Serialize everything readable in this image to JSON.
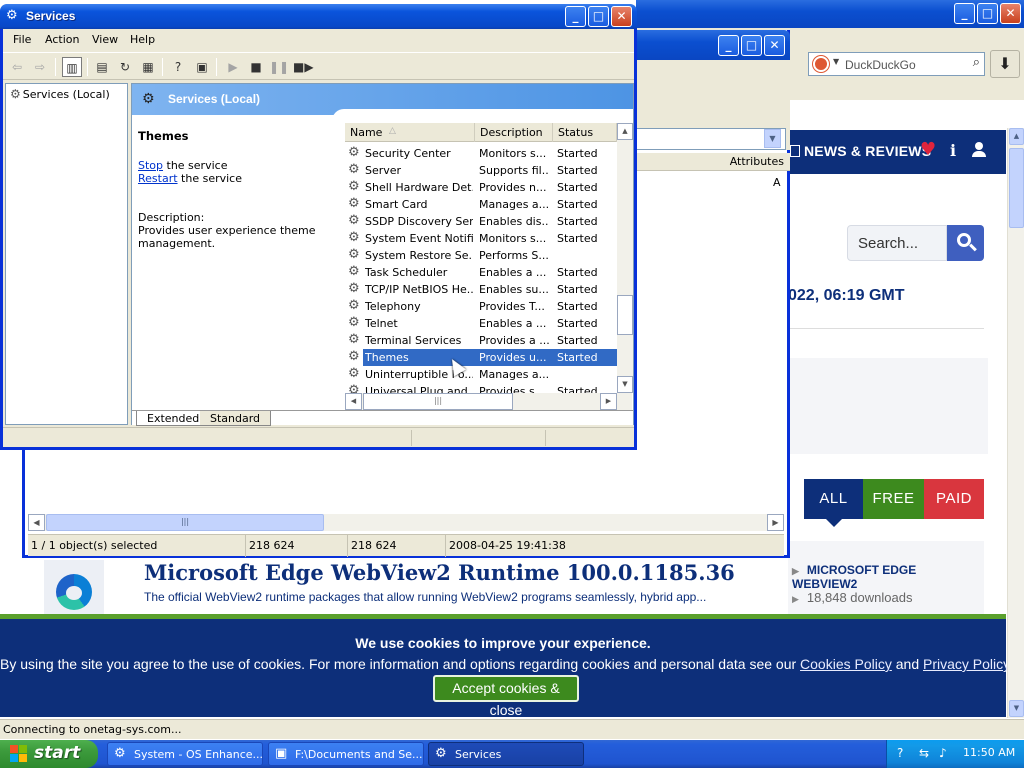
{
  "browser": {
    "search_placeholder": "DuckDuckGo",
    "nav": {
      "news": "NEWS & REVIEWS"
    },
    "site_search_placeholder": "Search...",
    "date_text": "022, 06:19 GMT",
    "filter_tabs": [
      "ALL",
      "FREE",
      "PAID"
    ],
    "side_link": "MICROSOFT EDGE WEBVIEW2",
    "side_downloads": "18,848 downloads",
    "product_title": "Microsoft Edge WebView2 Runtime 100.0.1185.36",
    "product_desc": "The official WebView2 runtime packages that allow running WebView2 programs seamlessly, hybrid app...",
    "cookie": {
      "title": "We use cookies to improve your experience.",
      "text_before": "By using the site you agree to the use of cookies. For more information and options regarding cookies and personal data see our ",
      "cookies_policy": "Cookies Policy",
      "and": " and ",
      "privacy_policy": "Privacy Policy",
      "accept": "Accept cookies & close"
    },
    "status": "Connecting to onetag-sys.com..."
  },
  "explorer": {
    "column_attributes": "Attributes",
    "attr_value": "A",
    "status": {
      "selected": "1 / 1 object(s) selected",
      "size1": "218 624",
      "size2": "218 624",
      "date": "2008-04-25 19:41:38"
    }
  },
  "services": {
    "title": "Services",
    "menu": [
      "File",
      "Action",
      "View",
      "Help"
    ],
    "tree_item": "Services (Local)",
    "header_title": "Services (Local)",
    "detail": {
      "title": "Themes",
      "stop_link": "Stop",
      "stop_rest": " the service",
      "restart_link": "Restart",
      "restart_rest": " the service",
      "desc_label": "Description:",
      "desc": "Provides user experience theme management."
    },
    "columns": {
      "name": "Name",
      "description": "Description",
      "status": "Status"
    },
    "rows": [
      {
        "name": "Security Center",
        "desc": "Monitors s...",
        "status": "Started"
      },
      {
        "name": "Server",
        "desc": "Supports fil...",
        "status": "Started"
      },
      {
        "name": "Shell Hardware Det...",
        "desc": "Provides n...",
        "status": "Started"
      },
      {
        "name": "Smart Card",
        "desc": "Manages a...",
        "status": "Started"
      },
      {
        "name": "SSDP Discovery Ser...",
        "desc": "Enables dis...",
        "status": "Started"
      },
      {
        "name": "System Event Notifi...",
        "desc": "Monitors s...",
        "status": "Started"
      },
      {
        "name": "System Restore Se...",
        "desc": "Performs S...",
        "status": ""
      },
      {
        "name": "Task Scheduler",
        "desc": "Enables a ...",
        "status": "Started"
      },
      {
        "name": "TCP/IP NetBIOS He...",
        "desc": "Enables su...",
        "status": "Started"
      },
      {
        "name": "Telephony",
        "desc": "Provides T...",
        "status": "Started"
      },
      {
        "name": "Telnet",
        "desc": "Enables a ...",
        "status": "Started"
      },
      {
        "name": "Terminal Services",
        "desc": "Provides a ...",
        "status": "Started"
      },
      {
        "name": "Themes",
        "desc": "Provides u...",
        "status": "Started"
      },
      {
        "name": "Uninterruptible Po...",
        "desc": "Manages a...",
        "status": ""
      },
      {
        "name": "Universal Plug and ...",
        "desc": "Provides s...",
        "status": "Started"
      }
    ],
    "selected_row": "Themes",
    "tabs": [
      "Extended",
      "Standard"
    ]
  },
  "taskbar": {
    "start": "start",
    "tasks": [
      {
        "label": "System - OS Enhance..."
      },
      {
        "label": "F:\\Documents and Se..."
      },
      {
        "label": "Services"
      }
    ],
    "clock": "11:50 AM"
  },
  "colors": {
    "xp_blue": "#0b4fd0",
    "site_navy": "#0d2f7a",
    "free_green": "#3d8a1e",
    "paid_red": "#d9363e",
    "selection": "#316ac5"
  }
}
